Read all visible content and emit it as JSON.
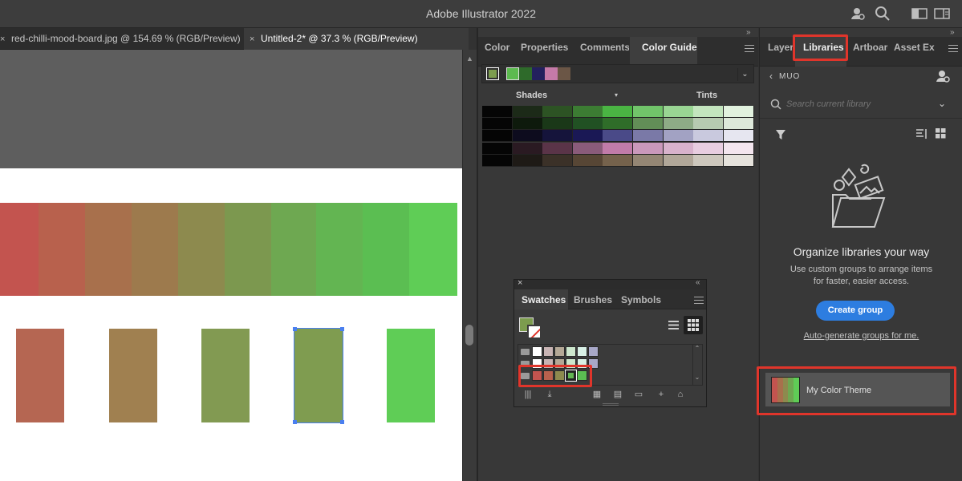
{
  "app": {
    "title": "Adobe Illustrator 2022"
  },
  "titlebar_icons": [
    "share-user-icon",
    "search-icon",
    "arrange-documents-icon",
    "workspace-switcher-icon"
  ],
  "doc_tabs": [
    {
      "label": "red-chilli-mood-board.jpg @ 154.69 % (RGB/Preview)",
      "active": false
    },
    {
      "label": "Untitled-2* @ 37.3 % (RGB/Preview)",
      "active": true
    }
  ],
  "close_glyph": "×",
  "artwork": {
    "strip_colors": [
      "#c3544f",
      "#b8614d",
      "#a8704c",
      "#9d7a4d",
      "#8d8a4e",
      "#7c984f",
      "#6ea851",
      "#63b552",
      "#5bbe52",
      "#5fcd56"
    ],
    "blocks": [
      "#b56652",
      "#a08050",
      "#829a52",
      "#7f9c50",
      "#5fcd56"
    ],
    "selected_block": 3
  },
  "color_guide": {
    "tabs": [
      {
        "label": "Color"
      },
      {
        "label": "Properties"
      },
      {
        "label": "Comments"
      },
      {
        "label": "Color Guide",
        "active": true
      }
    ],
    "base_color": "#7c9c4e",
    "harmony_swatches": [
      "#5cba4f",
      "#2e6a2a",
      "#23205e",
      "#c57aa8",
      "#6b5646"
    ],
    "shades_label": "Shades",
    "tints_label": "Tints",
    "grid": [
      [
        "#050505",
        "#1c2a18",
        "#2d5324",
        "#3c7c33",
        "#4ab443",
        "#71c46a",
        "#99d593",
        "#c3e5be",
        "#e2f2df"
      ],
      [
        "#050505",
        "#0e1a0c",
        "#1a3818",
        "#215123",
        "#2f6d29",
        "#628e57",
        "#8eab86",
        "#b7cab1",
        "#dde8da"
      ],
      [
        "#050505",
        "#0d0c1e",
        "#15143b",
        "#1a1855",
        "#4a4a88",
        "#7a79a7",
        "#a2a2c3",
        "#c9c9de",
        "#e6e6f0"
      ],
      [
        "#050505",
        "#2a1a22",
        "#5a3448",
        "#8a5b7a",
        "#c17ba9",
        "#ca98bb",
        "#d8b2cc",
        "#e8cde0",
        "#f3e5ee"
      ],
      [
        "#050505",
        "#1e1a16",
        "#3b3128",
        "#574635",
        "#75624c",
        "#948674",
        "#b1a799",
        "#cdc7bd",
        "#e5e2dc"
      ]
    ]
  },
  "swatches_panel": {
    "tabs": [
      {
        "label": "Swatches",
        "active": true
      },
      {
        "label": "Brushes"
      },
      {
        "label": "Symbols"
      }
    ],
    "fill_color": "#7c9c4e",
    "row1": [
      "#ffffff",
      "#c8b4b4",
      "#b4a896",
      "#cde7cd",
      "#d8f0e6",
      "#a8a8c8"
    ],
    "row2": [
      "#ffffff",
      "#c8b4b4",
      "#b4a896",
      "#cde7cd",
      "#d8f0e6",
      "#a8a8c8"
    ],
    "row3": [
      "#c3544f",
      "#b8614d",
      "#8d8a4e",
      "#63b552",
      "#5bbe52"
    ]
  },
  "libraries": {
    "tabs": [
      {
        "label": "Layers"
      },
      {
        "label": "Libraries",
        "active": true
      },
      {
        "label": "Artboards"
      },
      {
        "label": "Asset Ex"
      }
    ],
    "back_label": "MUO",
    "search_placeholder": "Search current library",
    "heading": "Organize libraries your way",
    "desc_line1": "Use custom groups to arrange items",
    "desc_line2": "for faster, easier access.",
    "create_group": "Create group",
    "auto_generate": "Auto-generate groups for me.",
    "theme_name": "My Color Theme",
    "theme_colors": [
      "#c3544f",
      "#a8704c",
      "#8d8a4e",
      "#6ea851",
      "#5fcd56"
    ]
  },
  "colors": {
    "accent": "#2d7de0",
    "highlight": "#e0352b"
  }
}
